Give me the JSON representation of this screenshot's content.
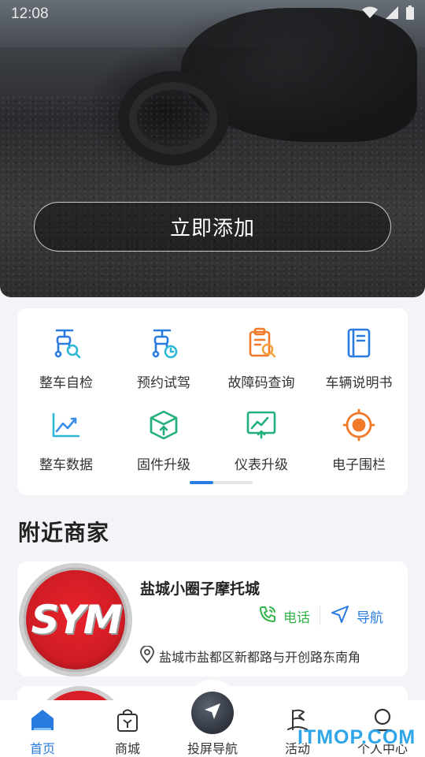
{
  "status_bar": {
    "time": "12:08",
    "icons": [
      "wifi-icon",
      "signal-icon",
      "battery-icon"
    ]
  },
  "hero": {
    "add_button_label": "立即添加"
  },
  "features": [
    {
      "label": "整车自检",
      "icon": "scooter-search-icon",
      "color": "#2a7be0"
    },
    {
      "label": "预约试驾",
      "icon": "scooter-clock-icon",
      "color": "#2a7be0"
    },
    {
      "label": "故障码查询",
      "icon": "clipboard-search-icon",
      "color": "#f07a2a"
    },
    {
      "label": "车辆说明书",
      "icon": "manual-book-icon",
      "color": "#2a7be0"
    },
    {
      "label": "整车数据",
      "icon": "line-chart-icon",
      "color": "#2db8d8"
    },
    {
      "label": "固件升级",
      "icon": "cube-upload-icon",
      "color": "#22b07a"
    },
    {
      "label": "仪表升级",
      "icon": "screen-upload-icon",
      "color": "#22b07a"
    },
    {
      "label": "电子围栏",
      "icon": "target-fence-icon",
      "color": "#f07a2a"
    }
  ],
  "pager": {
    "active_index": 0,
    "count": 2
  },
  "nearby": {
    "title": "附近商家",
    "dealers": [
      {
        "logo_text": "SYM",
        "name": "盐城小圈子摩托城",
        "phone_label": "电话",
        "nav_label": "导航",
        "address": "盐城市盐都区新都路与开创路东南角"
      }
    ]
  },
  "tabbar": {
    "items": [
      {
        "label": "首页",
        "icon": "home-icon",
        "active": true
      },
      {
        "label": "商城",
        "icon": "shopping-bag-icon",
        "active": false
      },
      {
        "label": "投屏导航",
        "icon": "navigation-arrow-icon",
        "active": false
      },
      {
        "label": "活动",
        "icon": "flag-icon",
        "active": false
      },
      {
        "label": "个人中心",
        "icon": "user-icon",
        "active": false
      }
    ]
  },
  "watermark": "ITMOP.COM",
  "colors": {
    "accent": "#2a7be0",
    "phone": "#34b34a",
    "background": "#f3f4f7"
  }
}
